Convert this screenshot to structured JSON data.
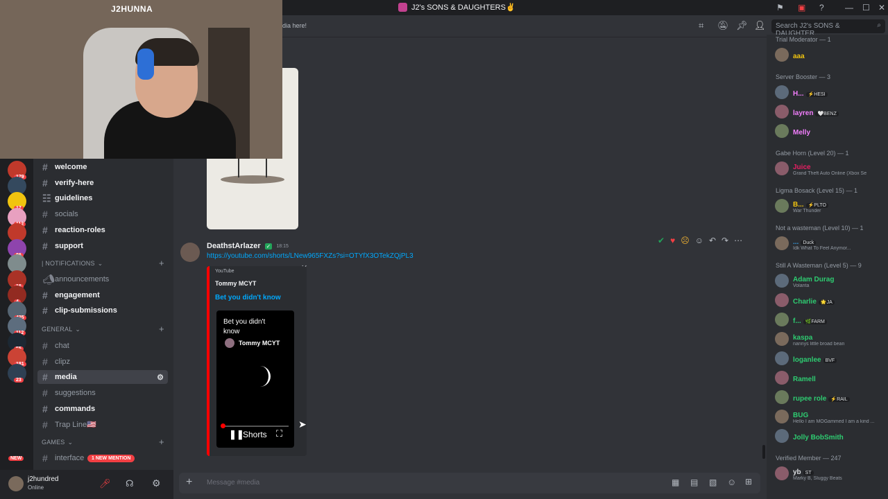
{
  "window": {
    "title": "J2's SONS & DAUGHTERS✌️",
    "controls": [
      "—",
      "☐",
      "✕"
    ]
  },
  "webcam": {
    "streamer_name": "J2HUNNA"
  },
  "guilds": [
    {
      "badge": "179",
      "color": "#c0392b"
    },
    {
      "badge": "",
      "color": "#34495e"
    },
    {
      "badge": "17",
      "color": "#f1c40f"
    },
    {
      "badge": "112",
      "color": "#e8a0c0"
    },
    {
      "badge": "",
      "color": "#c0392b"
    },
    {
      "badge": "86",
      "color": "#8e44ad"
    },
    {
      "badge": "",
      "color": "#7f8c8d"
    },
    {
      "badge": "16",
      "color": "#a93226"
    },
    {
      "badge": "4",
      "color": "#922b21"
    },
    {
      "badge": "435",
      "color": "#566573"
    },
    {
      "badge": "112",
      "color": "#5d6d7e"
    },
    {
      "badge": "55",
      "color": "#1c2833"
    },
    {
      "badge": "181",
      "color": "#cb4335"
    },
    {
      "badge": "23",
      "color": "#2e4053"
    }
  ],
  "new_badge": "NEW",
  "channels": {
    "items": [
      {
        "name": "welcome",
        "bold": true
      },
      {
        "name": "verify-here",
        "bold": true
      },
      {
        "name": "guidelines",
        "bold": true
      },
      {
        "name": "socials",
        "bold": false
      },
      {
        "name": "reaction-roles",
        "bold": true
      },
      {
        "name": "support",
        "bold": true
      }
    ],
    "cat_notifications": "| NOTIFICATIONS",
    "notif_items": [
      {
        "name": "announcements",
        "bold": false
      },
      {
        "name": "engagement",
        "bold": true
      },
      {
        "name": "clip-submissions",
        "bold": true
      }
    ],
    "cat_general": "GENERAL",
    "general_items": [
      {
        "name": "chat",
        "bold": false
      },
      {
        "name": "clipz",
        "bold": false
      },
      {
        "name": "media",
        "bold": true
      },
      {
        "name": "suggestions",
        "bold": false
      },
      {
        "name": "commands",
        "bold": true
      },
      {
        "name": "Trap Line🇺🇸",
        "bold": false
      }
    ],
    "cat_games": "GAMES",
    "games_items": [
      {
        "name": "interface",
        "bold": false
      }
    ],
    "mention_pill": "1 NEW MENTION"
  },
  "user": {
    "name": "j2hundred",
    "status": "Online"
  },
  "chat": {
    "header_text": "dia here!",
    "message": {
      "author": "DeathstArlazer",
      "time": "18:15",
      "link": "https://youtube.com/shorts/LNew965FXZs?si=OTYfX3OTekZQjPL3",
      "embed_provider": "YouTube",
      "embed_author": "Tommy MCYT",
      "embed_title": "Bet you didn't know",
      "video_title": "Bet you didn't know",
      "video_channel": "Tommy MCYT",
      "shorts_label": "Shorts"
    },
    "composer_placeholder": "Message #media"
  },
  "search": {
    "placeholder": "Search J2's SONS & DAUGHTER..."
  },
  "members": {
    "groups": [
      {
        "title": "Trial Moderator — 1",
        "members": [
          {
            "name": "aaa",
            "color": "#f1c40f",
            "activity": "",
            "tag": ""
          }
        ]
      },
      {
        "title": "Server Booster — 3",
        "members": [
          {
            "name": "H...",
            "color": "#f47fff",
            "activity": "",
            "tag": "⚡HESI"
          },
          {
            "name": "layren",
            "color": "#f47fff",
            "activity": "",
            "tag": "🤍BENZ"
          },
          {
            "name": "Melly",
            "color": "#f47fff",
            "activity": "",
            "tag": ""
          }
        ]
      },
      {
        "title": "Gabe Horn (Level 20) — 1",
        "members": [
          {
            "name": "Juice",
            "color": "#e91e63",
            "activity": "Grand Theft Auto Online (Xbox Se",
            "tag": ""
          }
        ]
      },
      {
        "title": "Ligma Bosack (Level 15) — 1",
        "members": [
          {
            "name": "B...",
            "color": "#f1c40f",
            "activity": "War Thunder",
            "tag": "⚡PLTO"
          }
        ]
      },
      {
        "title": "Not a wasteman (Level 10) — 1",
        "members": [
          {
            "name": "...",
            "color": "#3498db",
            "activity": "Idk What To Feel Anymor...",
            "tag": "Duck"
          }
        ]
      },
      {
        "title": "Still A Wasteman (Level 5) — 9",
        "members": [
          {
            "name": "Adam Durag",
            "color": "#2ecc71",
            "activity": "Volanta",
            "tag": ""
          },
          {
            "name": "Charlie",
            "color": "#2ecc71",
            "activity": "",
            "tag": "🌟JA"
          },
          {
            "name": "f...",
            "color": "#2ecc71",
            "activity": "",
            "tag": "🌿FARM"
          },
          {
            "name": "kaspa",
            "color": "#2ecc71",
            "activity": "nannys little broad bean",
            "tag": ""
          },
          {
            "name": "loganlee",
            "color": "#2ecc71",
            "activity": "",
            "tag": "BVF"
          },
          {
            "name": "Ramell",
            "color": "#2ecc71",
            "activity": "",
            "tag": ""
          },
          {
            "name": "rupee role",
            "color": "#2ecc71",
            "activity": "",
            "tag": "⚡RAIL"
          },
          {
            "name": "BUG",
            "color": "#2ecc71",
            "activity": "Hello I am MOGammed I am a kind ...",
            "tag": ""
          },
          {
            "name": "Jolly BobSmith",
            "color": "#2ecc71",
            "activity": "",
            "tag": ""
          }
        ]
      },
      {
        "title": "Verified Member — 247",
        "members": [
          {
            "name": "yb",
            "color": "#dbdee1",
            "activity": "Marky B, Sluggy Beats",
            "tag": "ST"
          }
        ]
      }
    ]
  },
  "colors": {
    "accent": "#5865f2",
    "mention": "#f23f43",
    "youtube": "#ff0000",
    "link": "#00a8fc"
  }
}
